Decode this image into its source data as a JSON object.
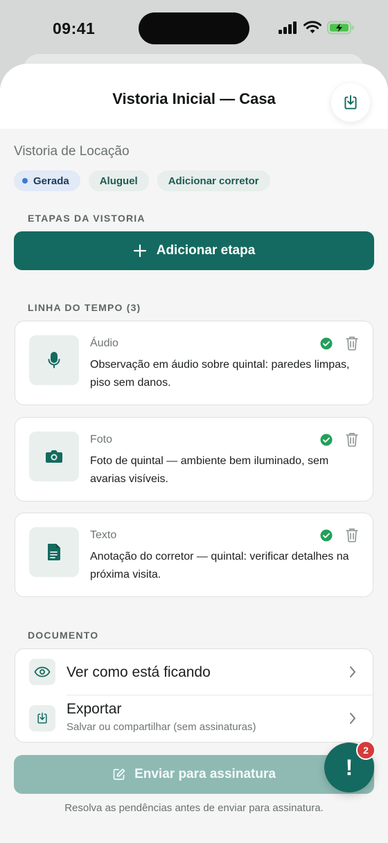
{
  "status": {
    "time": "09:41"
  },
  "header": {
    "title": "Vistoria Inicial — Casa"
  },
  "subtitle": "Vistoria de Locação",
  "chips": [
    "Gerada",
    "Aluguel",
    "Adicionar corretor"
  ],
  "steps_section": {
    "label": "ETAPAS DA VISTORIA",
    "add_button": "Adicionar etapa"
  },
  "timeline": {
    "label": "LINHA DO TEMPO (3)",
    "items": [
      {
        "type": "Áudio",
        "description": "Observação em áudio sobre quintal: paredes limpas, piso sem danos.",
        "icon": "microphone-icon"
      },
      {
        "type": "Foto",
        "description": "Foto de quintal — ambiente bem iluminado, sem avarias visíveis.",
        "icon": "camera-icon"
      },
      {
        "type": "Texto",
        "description": "Anotação do corretor — quintal: verificar detalhes na próxima visita.",
        "icon": "document-icon"
      }
    ]
  },
  "document": {
    "label": "DOCUMENTO",
    "preview": {
      "title": "Ver como está ficando"
    },
    "export": {
      "title": "Exportar",
      "subtitle": "Salvar ou compartilhar (sem assinaturas)"
    }
  },
  "send_button": "Enviar para assinatura",
  "helper_text": "Resolva as pendências antes de enviar para assinatura.",
  "fab": {
    "symbol": "!",
    "badge": "2"
  },
  "colors": {
    "accent": "#146a60",
    "success": "#22a05a",
    "badge": "#d73a3a"
  }
}
